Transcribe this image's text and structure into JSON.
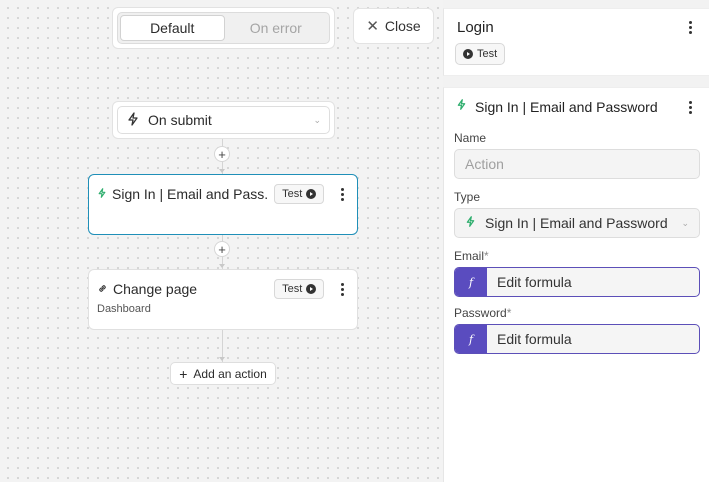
{
  "toggle": {
    "default_label": "Default",
    "error_label": "On error"
  },
  "close": {
    "label": "Close"
  },
  "trigger": {
    "label": "On submit"
  },
  "workflow": {
    "steps": [
      {
        "title": "Sign In | Email and Pass...",
        "test_label": "Test",
        "subtitle": ""
      },
      {
        "title": "Change page",
        "test_label": "Test",
        "subtitle": "Dashboard"
      }
    ],
    "add_action_label": "Add an action"
  },
  "login_panel": {
    "title": "Login",
    "test_label": "Test"
  },
  "action_panel": {
    "title": "Sign In | Email and Password",
    "name_label": "Name",
    "name_placeholder": "Action",
    "type_label": "Type",
    "type_value": "Sign In | Email and Password",
    "email_label": "Email",
    "email_formula": "Edit formula",
    "password_label": "Password",
    "password_formula": "Edit formula",
    "required_mark": "*"
  },
  "colors": {
    "selected_border": "#1f8fb8",
    "formula_accent": "#5a4cbf",
    "auth_icon": "#2fae6e"
  }
}
